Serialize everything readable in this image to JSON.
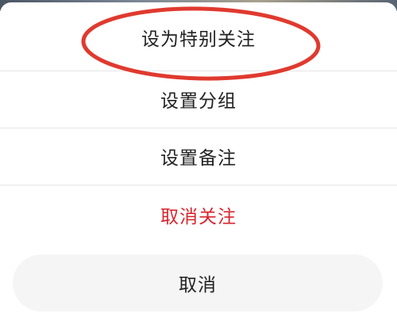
{
  "menu": {
    "items": [
      {
        "label": "设为特别关注"
      },
      {
        "label": "设置分组"
      },
      {
        "label": "设置备注"
      },
      {
        "label": "取消关注"
      }
    ],
    "cancel_label": "取消"
  },
  "colors": {
    "destructive": "#d8262f",
    "annotation": "#e03a2f",
    "text": "#222222",
    "cancel_bg": "#f5f5f5"
  }
}
